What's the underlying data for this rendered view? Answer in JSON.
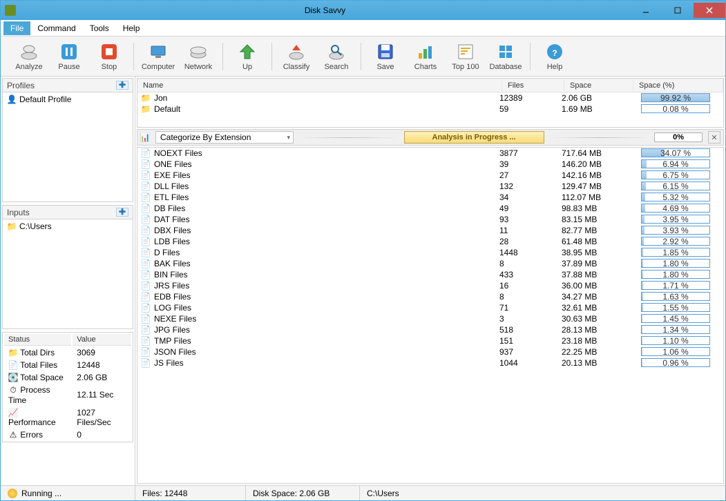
{
  "title": "Disk Savvy",
  "menu": [
    "File",
    "Command",
    "Tools",
    "Help"
  ],
  "toolbar": [
    {
      "id": "analyze",
      "label": "Analyze"
    },
    {
      "id": "pause",
      "label": "Pause"
    },
    {
      "id": "stop",
      "label": "Stop"
    },
    {
      "sep": true
    },
    {
      "id": "computer",
      "label": "Computer"
    },
    {
      "id": "network",
      "label": "Network"
    },
    {
      "sep": true
    },
    {
      "id": "up",
      "label": "Up"
    },
    {
      "sep": true
    },
    {
      "id": "classify",
      "label": "Classify"
    },
    {
      "id": "search",
      "label": "Search"
    },
    {
      "sep": true
    },
    {
      "id": "save",
      "label": "Save"
    },
    {
      "id": "charts",
      "label": "Charts"
    },
    {
      "id": "top100",
      "label": "Top 100"
    },
    {
      "id": "database",
      "label": "Database"
    },
    {
      "sep": true
    },
    {
      "id": "help",
      "label": "Help"
    }
  ],
  "profiles": {
    "header": "Profiles",
    "items": [
      {
        "label": "Default Profile"
      }
    ]
  },
  "inputs": {
    "header": "Inputs",
    "items": [
      {
        "label": "C:\\Users"
      }
    ]
  },
  "status_panel": {
    "cols": [
      "Status",
      "Value"
    ],
    "rows": [
      {
        "k": "Total Dirs",
        "v": "3069"
      },
      {
        "k": "Total Files",
        "v": "12448"
      },
      {
        "k": "Total Space",
        "v": "2.06 GB"
      },
      {
        "k": "Process Time",
        "v": "12.11 Sec"
      },
      {
        "k": "Performance",
        "v": "1027 Files/Sec"
      },
      {
        "k": "Errors",
        "v": "0"
      }
    ]
  },
  "folder_cols": [
    "Name",
    "Files",
    "Space",
    "Space (%)"
  ],
  "folders": [
    {
      "name": "Jon",
      "files": "12389",
      "space": "2.06 GB",
      "pct": "99.92 %",
      "fill": 99.92
    },
    {
      "name": "Default",
      "files": "59",
      "space": "1.69 MB",
      "pct": "0.08 %",
      "fill": 0.08
    }
  ],
  "categorize": {
    "label": "Categorize By Extension",
    "progress": "Analysis in Progress ...",
    "pct": "0%"
  },
  "ext_rows": [
    {
      "name": "NOEXT Files",
      "files": "3877",
      "space": "717.64 MB",
      "pct": "34.07 %",
      "fill": 34.07
    },
    {
      "name": "ONE Files",
      "files": "39",
      "space": "146.20 MB",
      "pct": "6.94 %",
      "fill": 6.94
    },
    {
      "name": "EXE Files",
      "files": "27",
      "space": "142.16 MB",
      "pct": "6.75 %",
      "fill": 6.75
    },
    {
      "name": "DLL Files",
      "files": "132",
      "space": "129.47 MB",
      "pct": "6.15 %",
      "fill": 6.15
    },
    {
      "name": "ETL Files",
      "files": "34",
      "space": "112.07 MB",
      "pct": "5.32 %",
      "fill": 5.32
    },
    {
      "name": "DB Files",
      "files": "49",
      "space": "98.83 MB",
      "pct": "4.69 %",
      "fill": 4.69
    },
    {
      "name": "DAT Files",
      "files": "93",
      "space": "83.15 MB",
      "pct": "3.95 %",
      "fill": 3.95
    },
    {
      "name": "DBX Files",
      "files": "11",
      "space": "82.77 MB",
      "pct": "3.93 %",
      "fill": 3.93
    },
    {
      "name": "LDB Files",
      "files": "28",
      "space": "61.48 MB",
      "pct": "2.92 %",
      "fill": 2.92
    },
    {
      "name": "D Files",
      "files": "1448",
      "space": "38.95 MB",
      "pct": "1.85 %",
      "fill": 1.85
    },
    {
      "name": "BAK Files",
      "files": "8",
      "space": "37.89 MB",
      "pct": "1.80 %",
      "fill": 1.8
    },
    {
      "name": "BIN Files",
      "files": "433",
      "space": "37.88 MB",
      "pct": "1.80 %",
      "fill": 1.8
    },
    {
      "name": "JRS Files",
      "files": "16",
      "space": "36.00 MB",
      "pct": "1.71 %",
      "fill": 1.71
    },
    {
      "name": "EDB Files",
      "files": "8",
      "space": "34.27 MB",
      "pct": "1.63 %",
      "fill": 1.63
    },
    {
      "name": "LOG Files",
      "files": "71",
      "space": "32.61 MB",
      "pct": "1.55 %",
      "fill": 1.55
    },
    {
      "name": "NEXE Files",
      "files": "3",
      "space": "30.63 MB",
      "pct": "1.45 %",
      "fill": 1.45
    },
    {
      "name": "JPG Files",
      "files": "518",
      "space": "28.13 MB",
      "pct": "1.34 %",
      "fill": 1.34
    },
    {
      "name": "TMP Files",
      "files": "151",
      "space": "23.18 MB",
      "pct": "1.10 %",
      "fill": 1.1
    },
    {
      "name": "JSON Files",
      "files": "937",
      "space": "22.25 MB",
      "pct": "1.06 %",
      "fill": 1.06
    },
    {
      "name": "JS Files",
      "files": "1044",
      "space": "20.13 MB",
      "pct": "0.96 %",
      "fill": 0.96
    }
  ],
  "statusbar": {
    "state": "Running ...",
    "files": "Files: 12448",
    "disk": "Disk Space: 2.06 GB",
    "path": "C:\\Users"
  }
}
